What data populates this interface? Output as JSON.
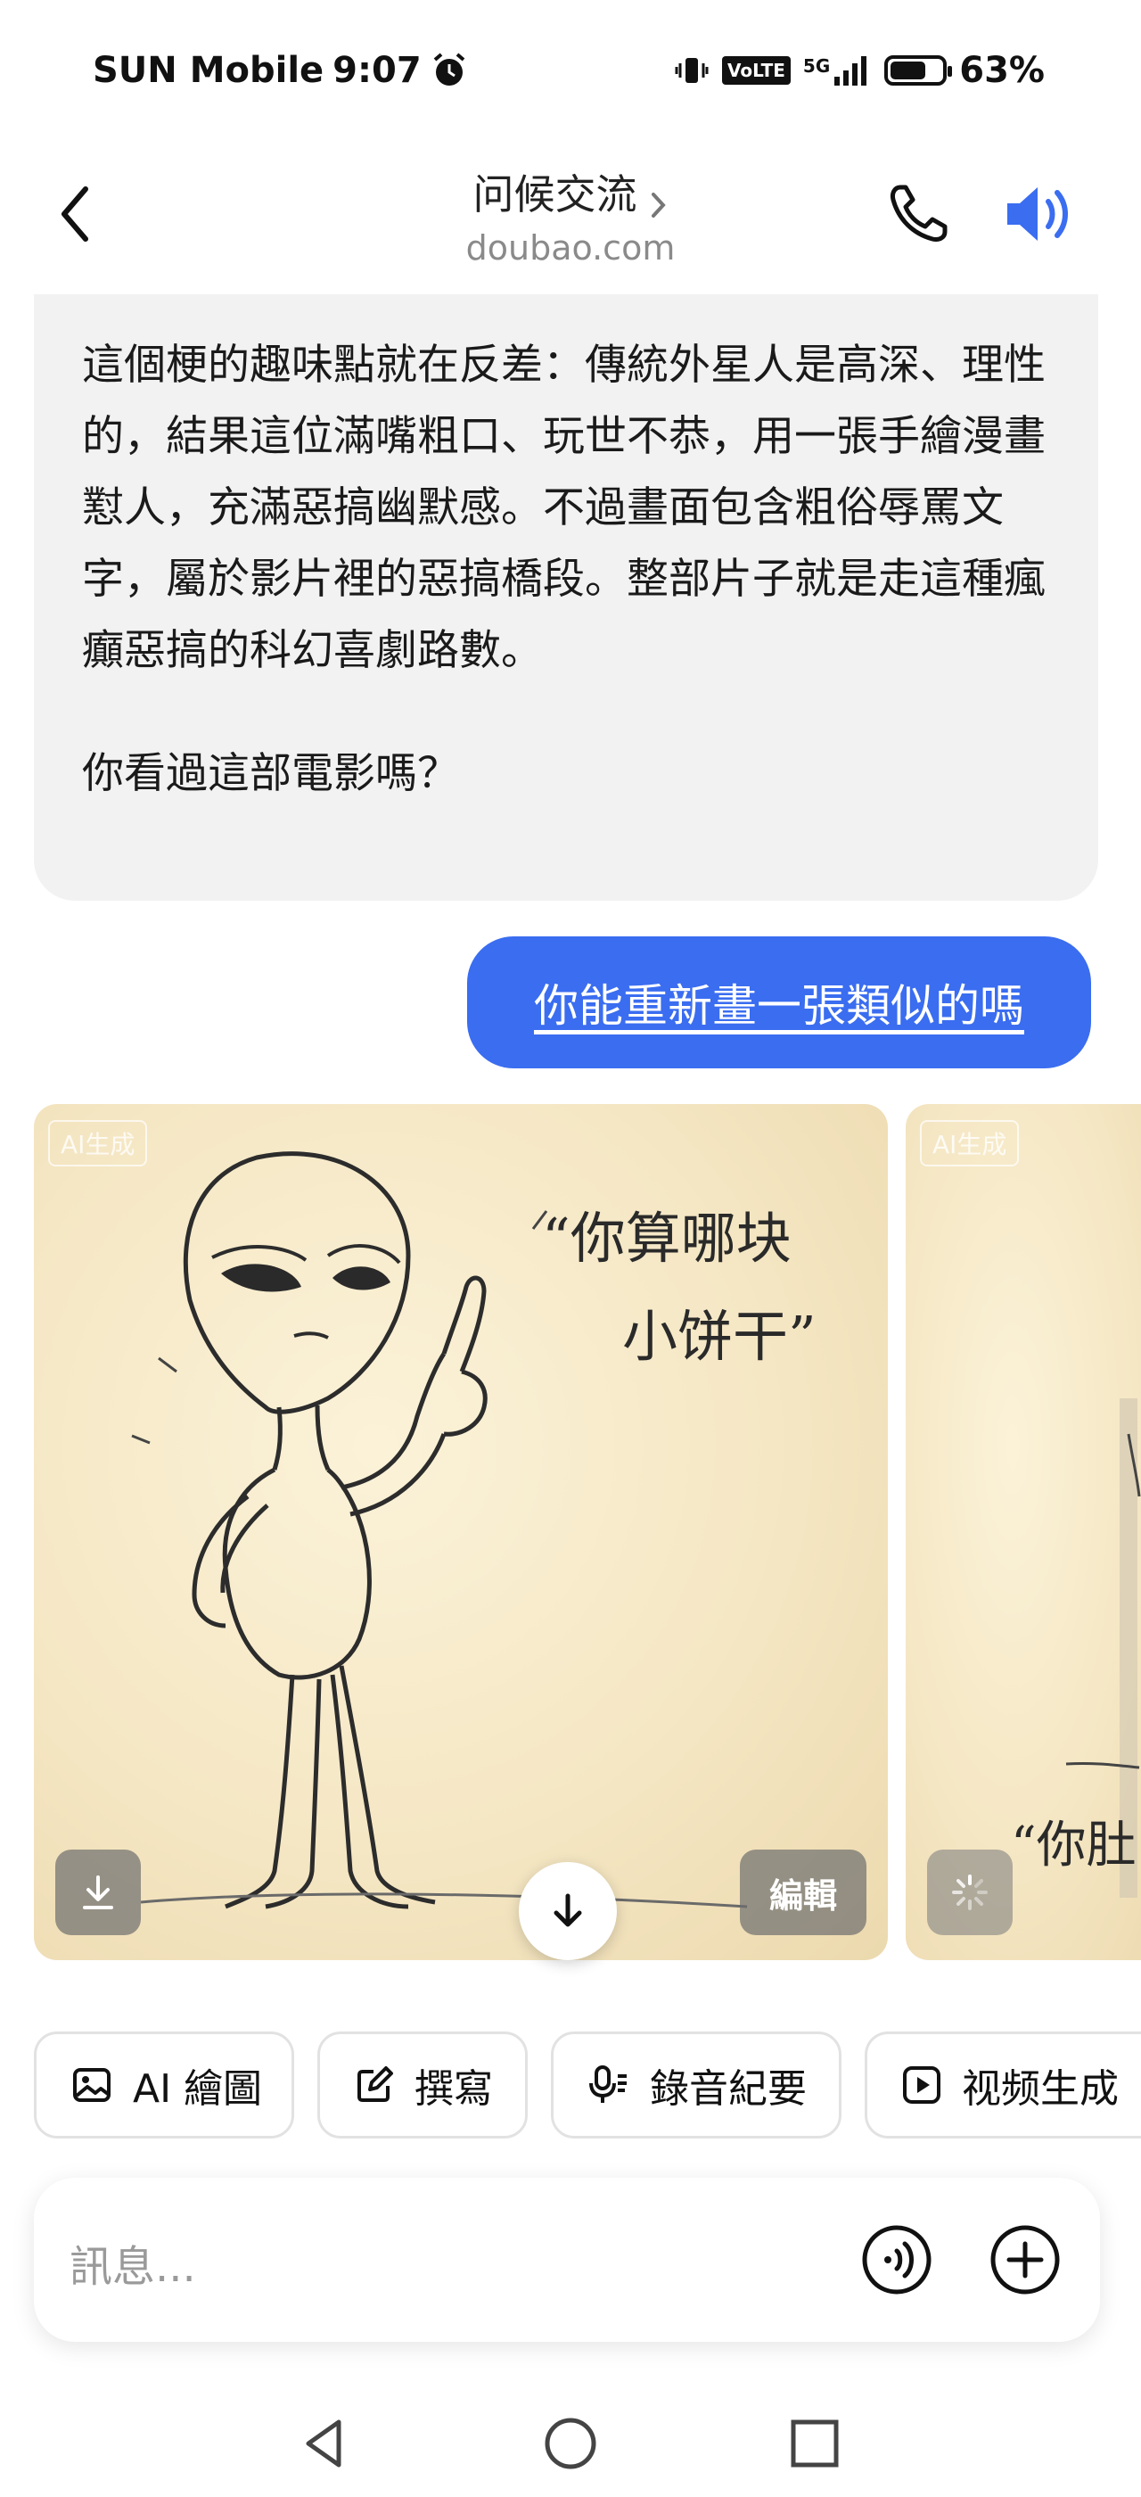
{
  "status_bar": {
    "carrier": "SUN Mobile",
    "time": "9:07",
    "network_badge": "VoLTE",
    "network_gen": "5G",
    "battery": "63%",
    "battery_level": 0.63
  },
  "header": {
    "title": "问候交流",
    "subtitle": "doubao.com",
    "icons": [
      "back-icon",
      "chevron-right-icon",
      "phone-icon",
      "speaker-icon"
    ]
  },
  "chat": {
    "ai_message": {
      "paragraph1": "這個梗的趣味點就在反差：傳統外星人是高深、理性的，結果這位滿嘴粗口、玩世不恭，用一張手繪漫畫懟人，充滿惡搞幽默感。不過畫面包含粗俗辱罵文字，屬於影片裡的惡搞橋段。整部片子就是走這種瘋癲惡搞的科幻喜劇路數。",
      "paragraph2": "你看過這部電影嗎？"
    },
    "user_message": "你能重新畫一張類似的嗎",
    "images": [
      {
        "tag": "AI生成",
        "caption_line1": "“你算哪块",
        "caption_line2": "小饼干”",
        "edit_label": "編輯"
      },
      {
        "tag": "AI生成",
        "caption_partial": "“你肚"
      }
    ]
  },
  "chips": [
    {
      "label": "AI 繪圖",
      "icon": "image-icon"
    },
    {
      "label": "撰寫",
      "icon": "edit-icon"
    },
    {
      "label": "錄音紀要",
      "icon": "mic-icon"
    },
    {
      "label": "视频生成",
      "icon": "play-icon"
    }
  ],
  "input": {
    "placeholder": "訊息..."
  },
  "colors": {
    "accent": "#3a6df0",
    "bubble_bg": "#f2f2f2"
  }
}
